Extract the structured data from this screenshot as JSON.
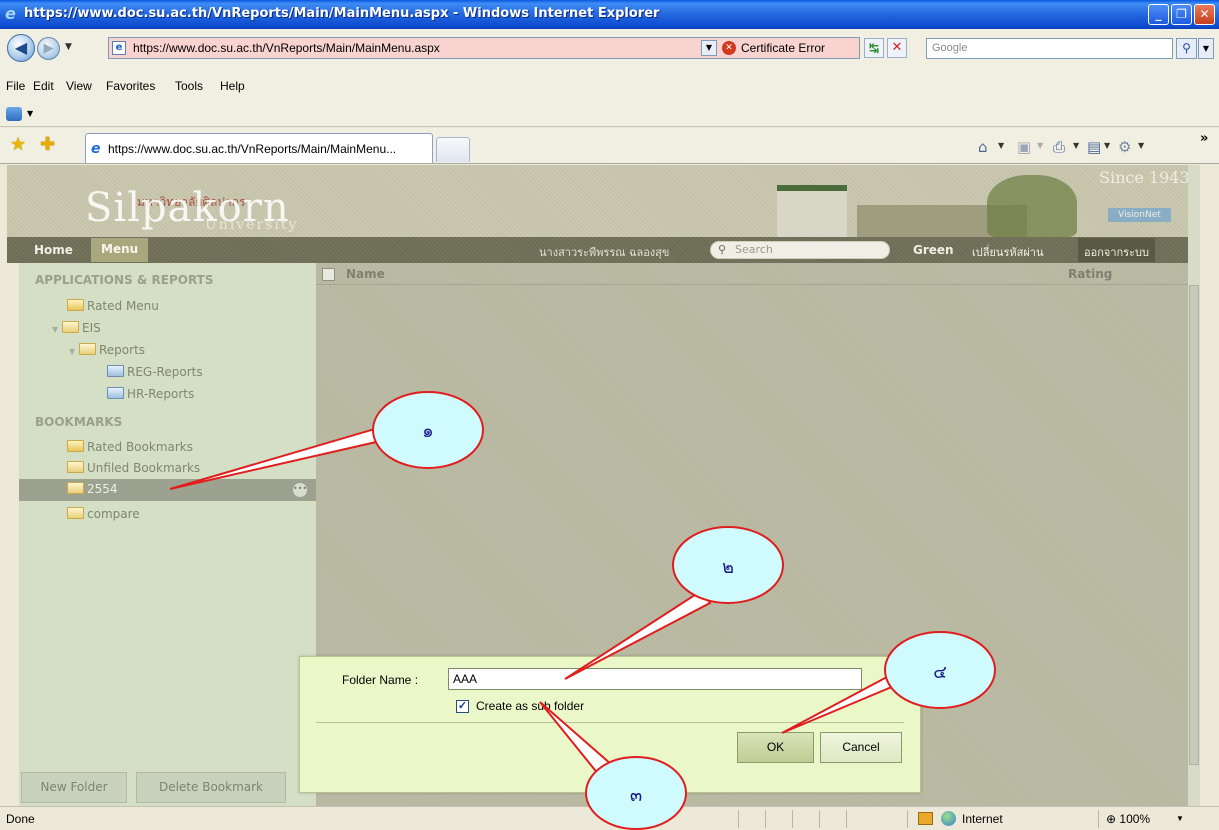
{
  "window": {
    "title": "https://www.doc.su.ac.th/VnReports/Main/MainMenu.aspx - Windows Internet Explorer",
    "minimize_glyph": "_",
    "maximize_glyph": "❐",
    "close_glyph": "✕"
  },
  "address_bar": {
    "url": "https://www.doc.su.ac.th/VnReports/Main/MainMenu.aspx",
    "certificate": "Certificate Error",
    "search_placeholder": "Google"
  },
  "menu": [
    "File",
    "Edit",
    "View",
    "Favorites",
    "Tools",
    "Help"
  ],
  "tabs": [
    {
      "label": "https://www.doc.su.ac.th/VnReports/Main/MainMenu..."
    }
  ],
  "toolbar_icons": [
    "favorites-star-icon",
    "add-favorites-icon",
    "home-icon",
    "feeds-icon",
    "print-icon",
    "page-icon",
    "tools-gear-icon"
  ],
  "banner": {
    "brand": "Silpakorn",
    "brand_sub": "University",
    "brand_thai": "มหาวิทยาลัยศิลปากร",
    "since": "Since 1943",
    "vendor_logo": "VisionNet"
  },
  "site_nav": {
    "home": "Home",
    "menu": "Menu",
    "user": "นางสาวระพีพรรณ ฉลองสุข",
    "search_placeholder": "Search",
    "theme": "Green",
    "change_password": "เปลี่ยนรหัสผ่าน",
    "logout": "ออกจากระบบ"
  },
  "sidebar": {
    "apps_header": "APPLICATIONS & REPORTS",
    "apps_items": [
      {
        "label": "Rated Menu",
        "icon": "rated-folder-icon"
      },
      {
        "label": "EIS",
        "icon": "folder-icon"
      },
      {
        "label": "Reports",
        "icon": "folder-icon"
      },
      {
        "label": "REG-Reports",
        "icon": "report-icon"
      },
      {
        "label": "HR-Reports",
        "icon": "report-icon"
      }
    ],
    "bookmarks_header": "BOOKMARKS",
    "bookmark_items": [
      {
        "label": "Rated Bookmarks",
        "icon": "rated-folder-icon"
      },
      {
        "label": "Unfiled Bookmarks",
        "icon": "folder-icon"
      },
      {
        "label": "2554",
        "icon": "folder-icon"
      },
      {
        "label": "compare",
        "icon": "folder-icon"
      }
    ],
    "new_folder": "New Folder",
    "delete_bookmark": "Delete Bookmark"
  },
  "list": {
    "col_name": "Name",
    "col_rating": "Rating"
  },
  "dialog": {
    "folder_label": "Folder Name :",
    "folder_value": "AAA",
    "subfolder_label": "Create as sub folder",
    "subfolder_checked": true,
    "ok": "OK",
    "cancel": "Cancel"
  },
  "callouts": [
    "๑",
    "๒",
    "๓",
    "๔"
  ],
  "status": {
    "text": "Done",
    "zone": "Internet",
    "zoom": "100%"
  }
}
